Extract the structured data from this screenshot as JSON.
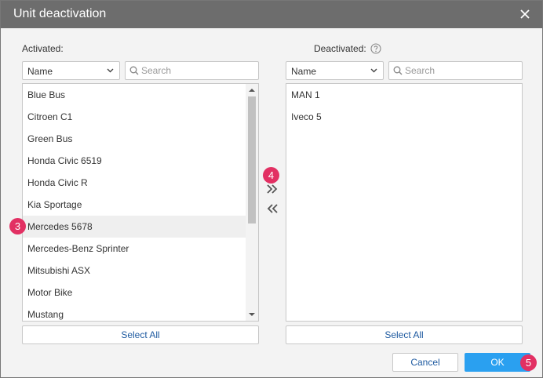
{
  "dialog": {
    "title": "Unit deactivation",
    "close_icon": "close-icon"
  },
  "activated": {
    "label": "Activated:",
    "sort_select": "Name",
    "search_placeholder": "Search",
    "items": [
      "Blue Bus",
      "Citroen C1",
      "Green Bus",
      "Honda Civic 6519",
      "Honda Civic R",
      "Kia Sportage",
      "Mercedes 5678",
      "Mercedes-Benz Sprinter",
      "Mitsubishi ASX",
      "Motor Bike",
      "Mustang"
    ],
    "select_all": "Select All"
  },
  "deactivated": {
    "label": "Deactivated:",
    "help_icon": "help-icon",
    "sort_select": "Name",
    "search_placeholder": "Search",
    "items": [
      "MAN 1",
      "Iveco 5"
    ],
    "select_all": "Select All"
  },
  "move": {
    "to_deactivated_icon": "double-chevron-right-icon",
    "to_activated_icon": "double-chevron-left-icon"
  },
  "badges": [
    "3",
    "4",
    "5"
  ],
  "footer": {
    "cancel": "Cancel",
    "ok": "OK"
  },
  "colors": {
    "titlebar": "#6d6d6d",
    "accent": "#2aa0f0",
    "badge": "#e23063",
    "link": "#1e5aa0"
  }
}
